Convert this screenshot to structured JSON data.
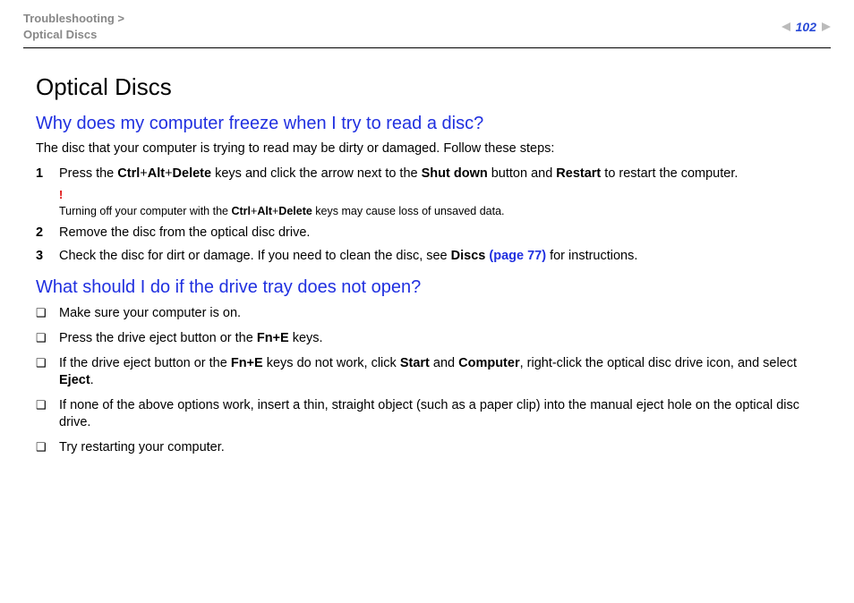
{
  "header": {
    "breadcrumb_line1": "Troubleshooting >",
    "breadcrumb_line2": "Optical Discs",
    "page_number": "102"
  },
  "title": "Optical Discs",
  "section1": {
    "heading": "Why does my computer freeze when I try to read a disc?",
    "intro": "The disc that your computer is trying to read may be dirty or damaged. Follow these steps:",
    "step1": {
      "pre": "Press the ",
      "k1": "Ctrl",
      "plus1": "+",
      "k2": "Alt",
      "plus2": "+",
      "k3": "Delete",
      "mid1": " keys and click the arrow next to the ",
      "b1": "Shut down",
      "mid2": " button and ",
      "b2": "Restart",
      "post": " to restart the computer."
    },
    "note": {
      "mark": "!",
      "pre": "Turning off your computer with the ",
      "k1": "Ctrl",
      "plus1": "+",
      "k2": "Alt",
      "plus2": "+",
      "k3": "Delete",
      "post": " keys may cause loss of unsaved data."
    },
    "step2": "Remove the disc from the optical disc drive.",
    "step3": {
      "pre": "Check the disc for dirt or damage. If you need to clean the disc, see ",
      "b1": "Discs ",
      "link": "(page 77)",
      "post": " for instructions."
    }
  },
  "section2": {
    "heading": "What should I do if the drive tray does not open?",
    "b1": "Make sure your computer is on.",
    "b2": {
      "pre": "Press the drive eject button or the ",
      "k": "Fn+E",
      "post": " keys."
    },
    "b3": {
      "pre": "If the drive eject button or the ",
      "k": "Fn+E",
      "mid1": " keys do not work, click ",
      "s1": "Start",
      "mid2": " and ",
      "s2": "Computer",
      "mid3": ", right-click the optical disc drive icon, and select ",
      "s3": "Eject",
      "post": "."
    },
    "b4": "If none of the above options work, insert a thin, straight object (such as a paper clip) into the manual eject hole on the optical disc drive.",
    "b5": "Try restarting your computer."
  }
}
